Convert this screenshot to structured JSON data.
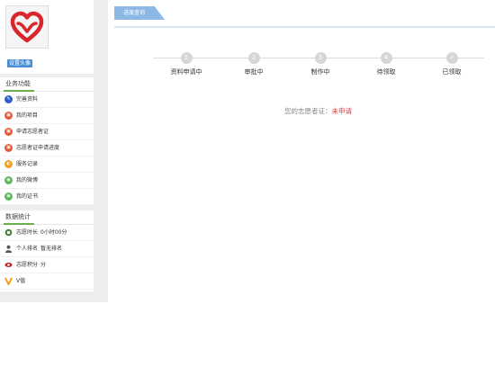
{
  "sidebar": {
    "set_avatar_label": "设置头像",
    "business": {
      "title": "业务功能",
      "items": [
        {
          "label": "完善资料",
          "icon": "edit-icon",
          "color": "#2f5fd0",
          "glyph": "✎"
        },
        {
          "label": "我的项目",
          "icon": "project-icon",
          "color": "#e05a3a",
          "glyph": "▣"
        },
        {
          "label": "申请志愿者证",
          "icon": "apply-card-icon",
          "color": "#e05a3a",
          "glyph": "▣"
        },
        {
          "label": "志愿者证申请进度",
          "icon": "progress-icon",
          "color": "#e05a3a",
          "glyph": "▣"
        },
        {
          "label": "服务记录",
          "icon": "service-record-icon",
          "color": "#f0a020",
          "glyph": "◐"
        },
        {
          "label": "我的微博",
          "icon": "weibo-icon",
          "color": "#5cb85c",
          "glyph": "◉"
        },
        {
          "label": "我的证书",
          "icon": "certificate-icon",
          "color": "#5cb85c",
          "glyph": "◉"
        }
      ]
    },
    "stats": {
      "title": "数据统计",
      "items": [
        {
          "label": "志愿时长",
          "value": "0小时00分",
          "icon": "clock-icon"
        },
        {
          "label": "个人排名",
          "value": "暂无排名",
          "icon": "user-icon"
        },
        {
          "label": "志愿积分",
          "value": "分",
          "icon": "eye-icon"
        },
        {
          "label": "V值",
          "value": "",
          "icon": "v-icon"
        }
      ]
    }
  },
  "tab": {
    "label": "进度查询"
  },
  "steps": [
    {
      "num": "1",
      "label": "资料申请中"
    },
    {
      "num": "2",
      "label": "审批中"
    },
    {
      "num": "3",
      "label": "制作中"
    },
    {
      "num": "4",
      "label": "待领取"
    },
    {
      "num": "✓",
      "label": "已领取"
    }
  ],
  "status": {
    "prefix": "您的志愿者证：",
    "value": "未申请"
  },
  "colors": {
    "accent": "#8cb8e6",
    "status": "#e0383e",
    "green_underline": "#6ab04c"
  }
}
